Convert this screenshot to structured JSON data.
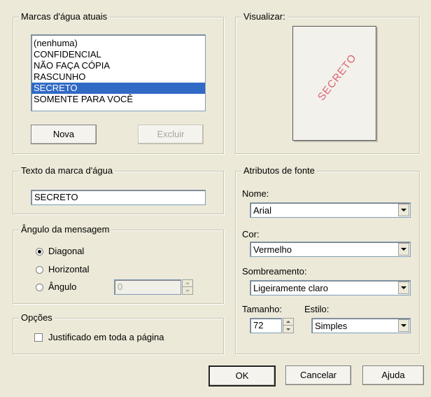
{
  "current_watermarks": {
    "legend": "Marcas d'água atuais",
    "items": [
      "(nenhuma)",
      "CONFIDENCIAL",
      "NÃO FAÇA CÓPIA",
      "RASCUNHO",
      "SECRETO",
      "SOMENTE PARA VOCÊ"
    ],
    "selected_index": 4,
    "new_button": "Nova",
    "delete_button": "Excluir"
  },
  "preview": {
    "legend": "Visualizar:",
    "watermark_text": "SECRETO",
    "watermark_color": "#e06070"
  },
  "watermark_text": {
    "legend": "Texto da marca d'água",
    "value": "SECRETO"
  },
  "message_angle": {
    "legend": "Ângulo da mensagem",
    "options": [
      "Diagonal",
      "Horizontal",
      "Ângulo"
    ],
    "selected": "Diagonal",
    "angle_value": "0"
  },
  "options": {
    "legend": "Opções",
    "justify_label": "Justificado em toda a página",
    "justify_checked": false
  },
  "font_attributes": {
    "legend": "Atributos de fonte",
    "name_label": "Nome:",
    "name_value": "Arial",
    "color_label": "Cor:",
    "color_value": "Vermelho",
    "shading_label": "Sombreamento:",
    "shading_value": "Ligeiramente claro",
    "size_label": "Tamanho:",
    "size_value": "72",
    "style_label": "Estilo:",
    "style_value": "Simples"
  },
  "buttons": {
    "ok": "OK",
    "cancel": "Cancelar",
    "help": "Ajuda"
  }
}
